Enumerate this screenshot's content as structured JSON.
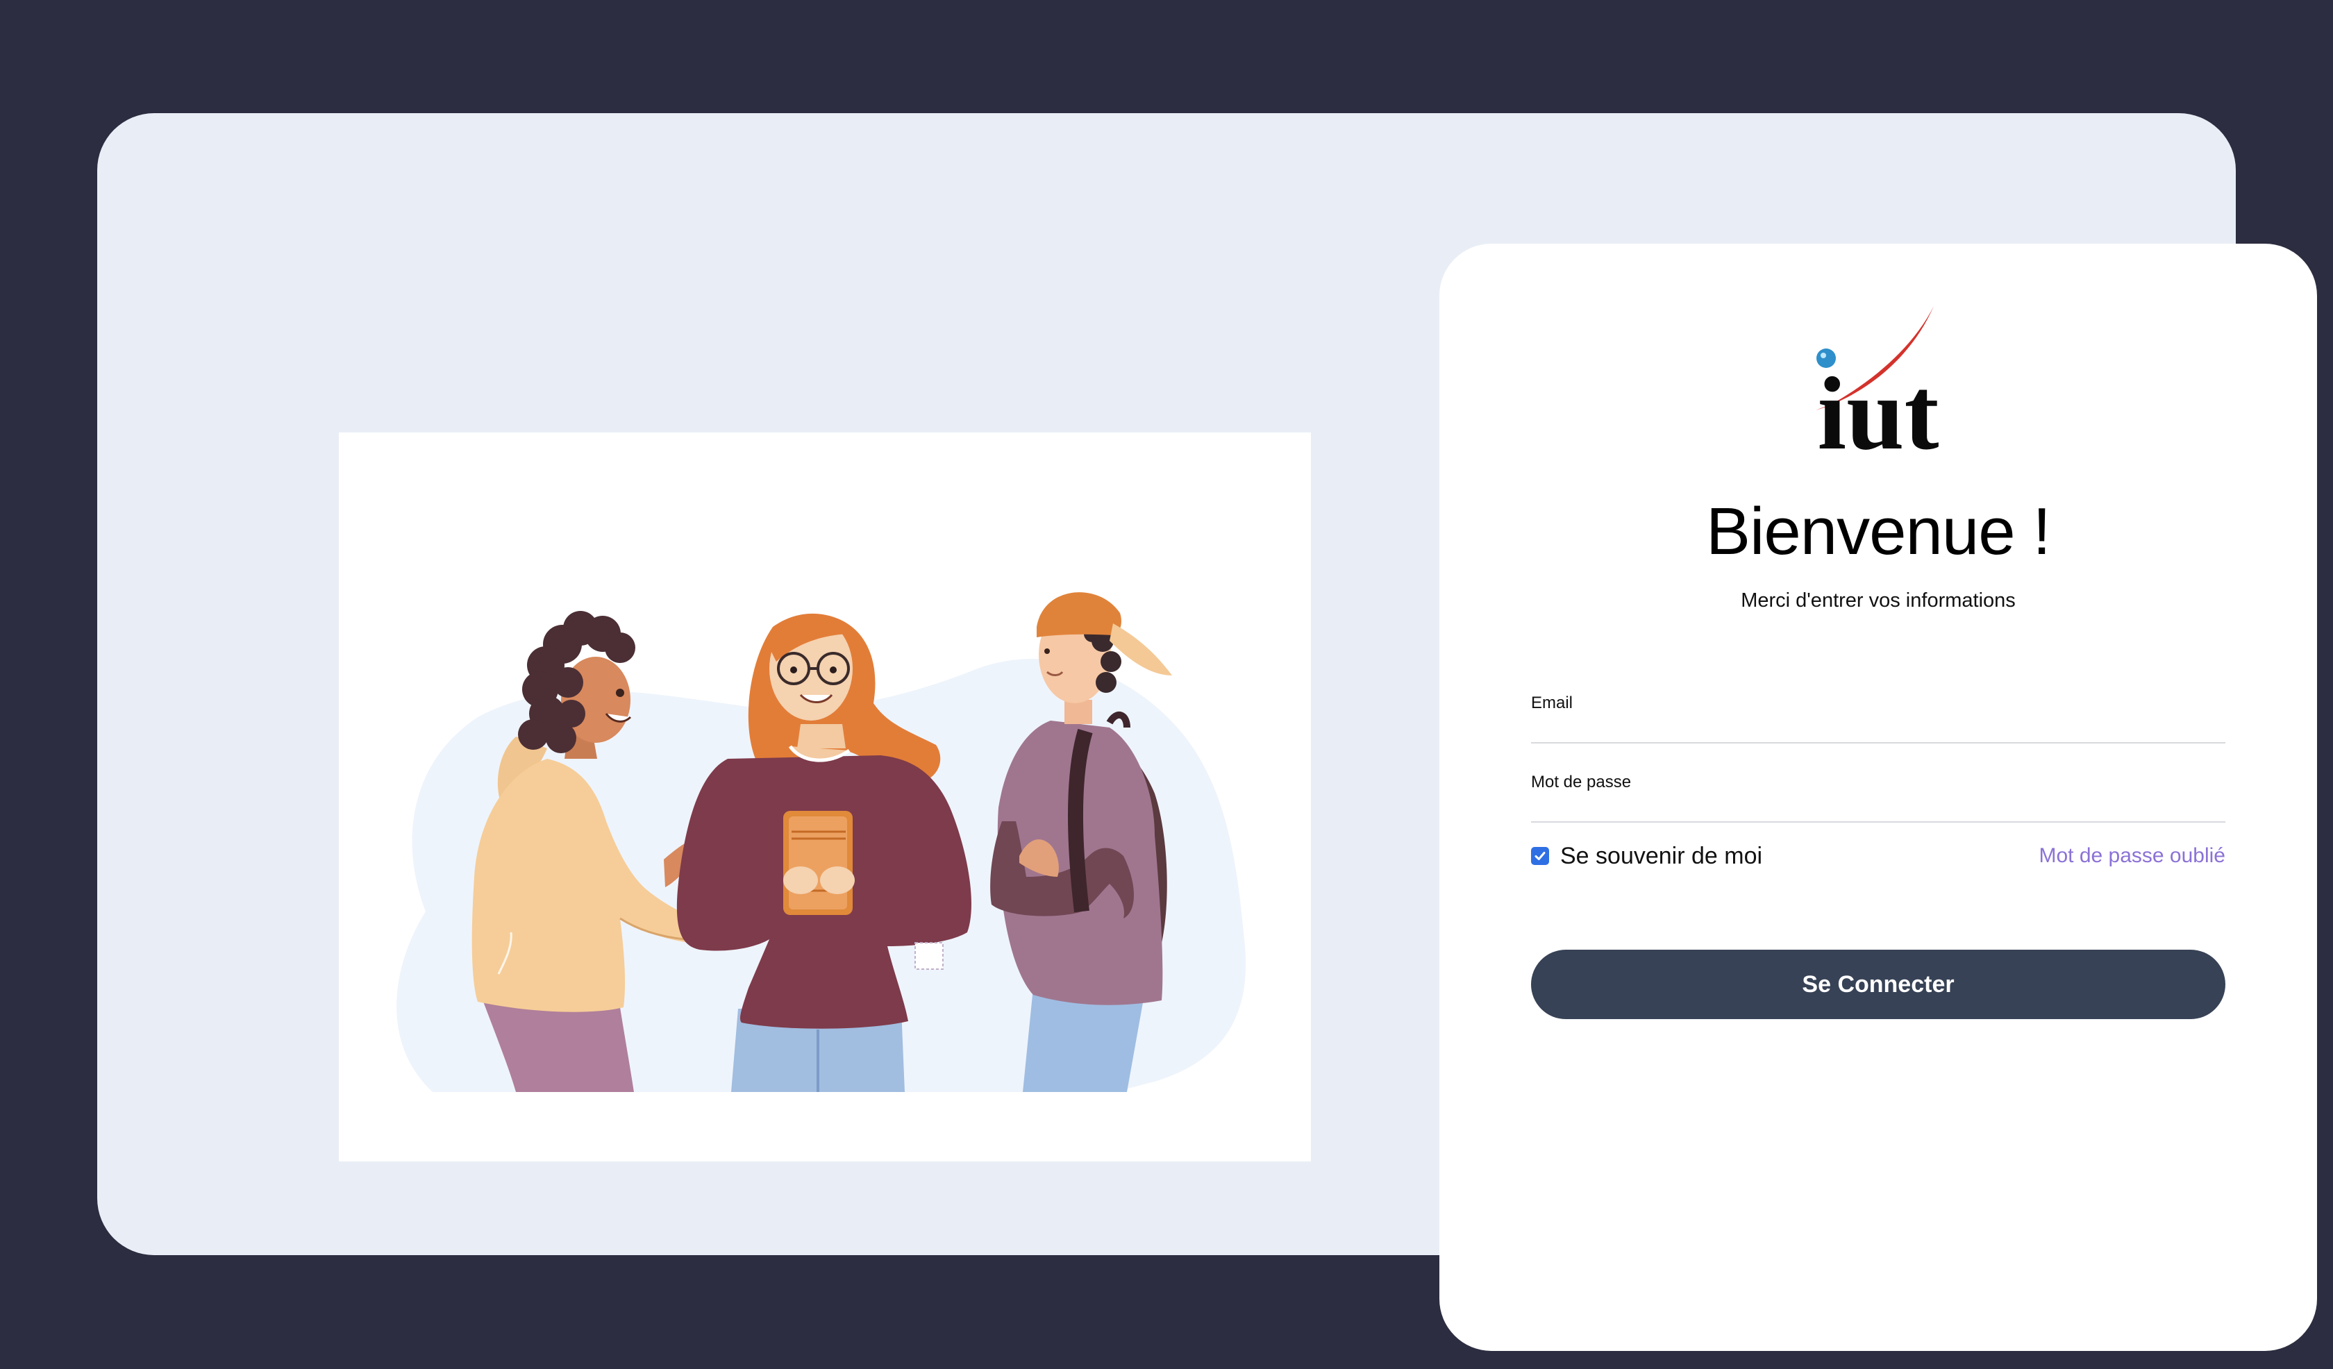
{
  "brand": {
    "logo_text": "iut",
    "colors": {
      "page_background": "#2c2d40",
      "shell_background": "#e9eef6",
      "card_background": "#ffffff",
      "button_background": "#374256",
      "link_color": "#8b72d6",
      "checkbox_color": "#2f6fe4"
    }
  },
  "illustration": {
    "icon": "students-illustration"
  },
  "login": {
    "title": "Bienvenue !",
    "subtitle": "Merci d'entrer vos informations",
    "email": {
      "label": "Email",
      "value": "",
      "placeholder": ""
    },
    "password": {
      "label": "Mot de passe",
      "value": "",
      "placeholder": ""
    },
    "remember_me": {
      "label": "Se souvenir de moi",
      "checked": true
    },
    "forgot_password_label": "Mot de passe oublié",
    "submit_label": "Se Connecter"
  }
}
